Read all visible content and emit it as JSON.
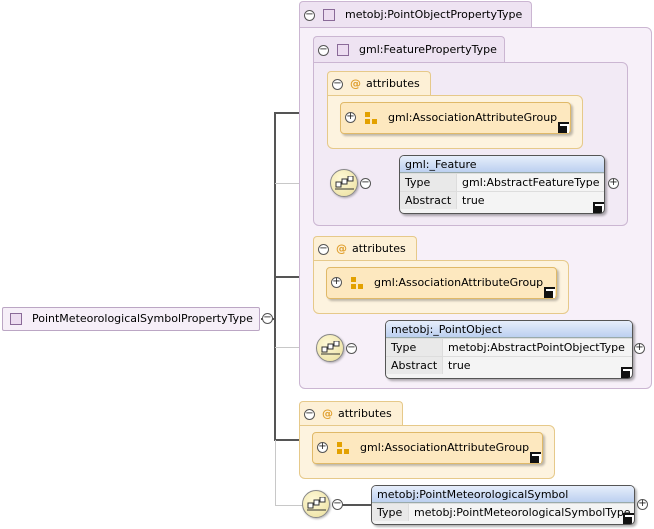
{
  "root": {
    "label": "PointMeteorologicalSymbolPropertyType"
  },
  "outer_type": {
    "label": "metobj:PointObjectPropertyType"
  },
  "inner_type": {
    "label": "gml:FeaturePropertyType"
  },
  "attributes_label": "attributes",
  "at_symbol": "@",
  "group_label": "gml:AssociationAttributeGroup",
  "expand_symbol": "+",
  "collapse_symbol": "−",
  "elements": {
    "feature": {
      "name": "gml:_Feature",
      "rows": [
        {
          "key": "Type",
          "value": "gml:AbstractFeatureType"
        },
        {
          "key": "Abstract",
          "value": "true"
        }
      ]
    },
    "point_object": {
      "name": "metobj:_PointObject",
      "rows": [
        {
          "key": "Type",
          "value": "metobj:AbstractPointObjectType"
        },
        {
          "key": "Abstract",
          "value": "true"
        }
      ]
    },
    "met_symbol": {
      "name": "metobj:PointMeteorologicalSymbol",
      "rows": [
        {
          "key": "Type",
          "value": "metobj:PointMeteorologicalSymbolType"
        }
      ]
    }
  },
  "icons": {
    "type_icon": "complex-type-icon",
    "group_icon": "attribute-group-icon",
    "sequence_icon": "sequence-compositor-icon",
    "link_icon": "link-arrow-icon"
  },
  "colors": {
    "type_bg": "#f7f0f9",
    "attr_bg": "#fdf3df",
    "group_bg": "#fde8bf",
    "element_header": "#bcd0f0"
  }
}
